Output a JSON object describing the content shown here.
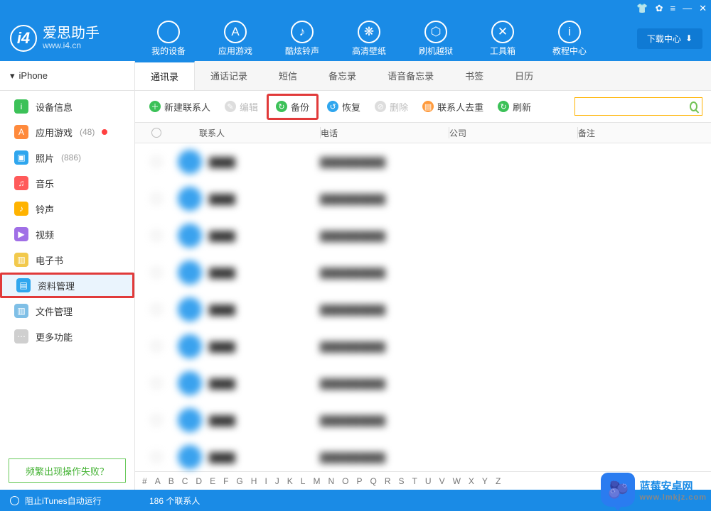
{
  "titlebar_icons": [
    "tshirt",
    "gear",
    "menu",
    "minimize",
    "close"
  ],
  "logo": {
    "cn": "爱思助手",
    "en": "www.i4.cn",
    "badge": "i4"
  },
  "nav": [
    {
      "label": "我的设备",
      "icon": ""
    },
    {
      "label": "应用游戏",
      "icon": "A"
    },
    {
      "label": "酷炫铃声",
      "icon": "♪"
    },
    {
      "label": "高清壁纸",
      "icon": "❋"
    },
    {
      "label": "刷机越狱",
      "icon": "⬡"
    },
    {
      "label": "工具箱",
      "icon": "✕"
    },
    {
      "label": "教程中心",
      "icon": "i"
    }
  ],
  "dlcenter": "下载中心",
  "device_name": "iPhone",
  "sidebar": [
    {
      "label": "设备信息",
      "icon": "i",
      "color": "#3cc158"
    },
    {
      "label": "应用游戏",
      "icon": "A",
      "color": "#ff8a3c",
      "count": "(48)",
      "dot": true
    },
    {
      "label": "照片",
      "icon": "▣",
      "color": "#2fa6ee",
      "count": "(886)"
    },
    {
      "label": "音乐",
      "icon": "♫",
      "color": "#ff5a5a"
    },
    {
      "label": "铃声",
      "icon": "♪",
      "color": "#ffb300"
    },
    {
      "label": "视频",
      "icon": "▶",
      "color": "#a06fe6"
    },
    {
      "label": "电子书",
      "icon": "▥",
      "color": "#f2c94c"
    },
    {
      "label": "资料管理",
      "icon": "▤",
      "color": "#2fa6ee",
      "highlighted": true
    },
    {
      "label": "文件管理",
      "icon": "▥",
      "color": "#7fbfe6"
    },
    {
      "label": "更多功能",
      "icon": "⋯",
      "color": "#cfcfcf"
    }
  ],
  "help_link": "频繁出现操作失败？",
  "tabs": [
    "通讯录",
    "通话记录",
    "短信",
    "备忘录",
    "语音备忘录",
    "书签",
    "日历"
  ],
  "active_tab": 0,
  "toolbar": [
    {
      "label": "新建联系人",
      "color": "#3cc158",
      "icon": "＋"
    },
    {
      "label": "编辑",
      "color": "#bbb",
      "icon": "✎",
      "disabled": true
    },
    {
      "label": "备份",
      "color": "#3cc158",
      "icon": "↻",
      "highlighted": true
    },
    {
      "label": "恢复",
      "color": "#2fa6ee",
      "icon": "↺"
    },
    {
      "label": "删除",
      "color": "#bbb",
      "icon": "⊘",
      "disabled": true
    },
    {
      "label": "联系人去重",
      "color": "#ff9a3c",
      "icon": "▤"
    },
    {
      "label": "刷新",
      "color": "#3cc158",
      "icon": "↻"
    }
  ],
  "search_placeholder": "",
  "columns": {
    "contact": "联系人",
    "phone": "电话",
    "company": "公司",
    "note": "备注"
  },
  "rows_count": 9,
  "alpha": [
    "#",
    "A",
    "B",
    "C",
    "D",
    "E",
    "F",
    "G",
    "H",
    "I",
    "J",
    "K",
    "L",
    "M",
    "N",
    "O",
    "P",
    "Q",
    "R",
    "S",
    "T",
    "U",
    "V",
    "W",
    "X",
    "Y",
    "Z"
  ],
  "footer": {
    "itunes": "阻止iTunes自动运行",
    "count": "186 个联系人"
  },
  "watermark": {
    "bubble": "🫐",
    "line1": "蓝莓安卓网",
    "line2": "www.lmkjz.com"
  }
}
